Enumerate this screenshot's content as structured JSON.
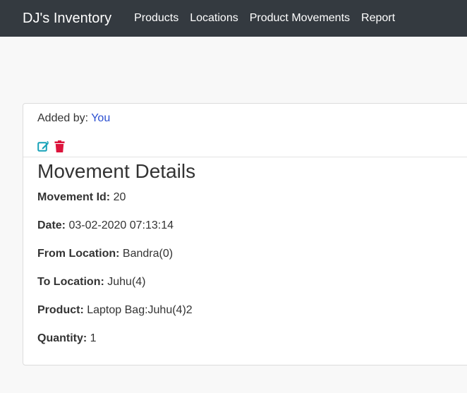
{
  "navbar": {
    "brand": "DJ's Inventory",
    "links": [
      "Products",
      "Locations",
      "Product Movements",
      "Report"
    ]
  },
  "card": {
    "added_by_label": "Added by: ",
    "added_by_value": "You",
    "heading": "Movement Details",
    "icons": [
      "edit-icon",
      "trash-icon"
    ],
    "colors": {
      "edit": "#17a2b8",
      "delete": "#dc143c",
      "author_link": "#2b4fd1"
    },
    "details": [
      {
        "label": "Movement Id:",
        "value": "20"
      },
      {
        "label": "Date:",
        "value": "03-02-2020 07:13:14"
      },
      {
        "label": "From Location:",
        "value": "Bandra(0)"
      },
      {
        "label": "To Location:",
        "value": "Juhu(4)"
      },
      {
        "label": "Product:",
        "value": "Laptop Bag:Juhu(4)2"
      },
      {
        "label": "Quantity:",
        "value": "1"
      }
    ]
  }
}
